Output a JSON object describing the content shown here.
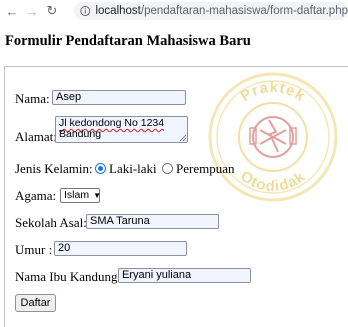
{
  "browser": {
    "url_host": "localhost",
    "url_path": "/pendaftaran-mahasiswa/form-daftar.php"
  },
  "page": {
    "title": "Formulir Pendaftaran Mahasiswa Baru"
  },
  "form": {
    "nama_label": "Nama:",
    "nama_value": "Asep",
    "alamat_label": "Alamat:",
    "alamat_line1": "Jl kedondong No 1234",
    "alamat_line2": "Bandung",
    "jenis_kelamin_label": "Jenis Kelamin:",
    "gender_option_male": "Laki-laki",
    "gender_option_female": "Perempuan",
    "gender_selected": "Laki-laki",
    "agama_label": "Agama:",
    "agama_value": "Islam",
    "sekolah_label": "Sekolah Asal:",
    "sekolah_value": "SMA Taruna",
    "umur_label": "Umur :",
    "umur_value": "20",
    "ibu_label": "Nama Ibu Kandung:",
    "ibu_value": "Eryani yuliana",
    "submit_label": "Daftar"
  },
  "watermark": {
    "text": "Praktek Otodidak",
    "color": "#e8c85a"
  },
  "colors": {
    "radio_accent": "#1a73e8",
    "input_bg": "#f0f5ff"
  }
}
